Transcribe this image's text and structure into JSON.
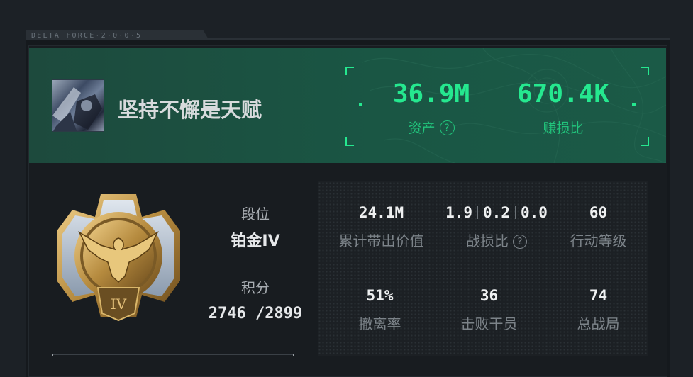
{
  "brand": {
    "text": "DELTA FORCE·2·0·0·5"
  },
  "player": {
    "name": "坚持不懈是天赋"
  },
  "header_stats": [
    {
      "value": "36.9M",
      "label": "资产",
      "has_help": true
    },
    {
      "value": "670.4K",
      "label": "赚损比",
      "has_help": false
    }
  ],
  "rank": {
    "tier_label": "段位",
    "tier_value": "铂金IV",
    "score_label": "积分",
    "score_value": "2746 /2899",
    "medal_numeral": "IV"
  },
  "stats": {
    "total_value": {
      "value": "24.1M",
      "label": "累计带出价值"
    },
    "kd": {
      "values": [
        "1.9",
        "0.2",
        "0.0"
      ],
      "label": "战损比"
    },
    "level": {
      "value": "60",
      "label": "行动等级"
    },
    "extract_rate": {
      "value": "51%",
      "label": "撤离率"
    },
    "kills": {
      "value": "36",
      "label": "击败干员"
    },
    "matches": {
      "value": "74",
      "label": "总战局"
    }
  },
  "colors": {
    "accent": "#25e88f",
    "header_bg": "#1a5644"
  },
  "icons": [
    "help-circle-icon",
    "rank-medal-icon",
    "avatar-image"
  ]
}
